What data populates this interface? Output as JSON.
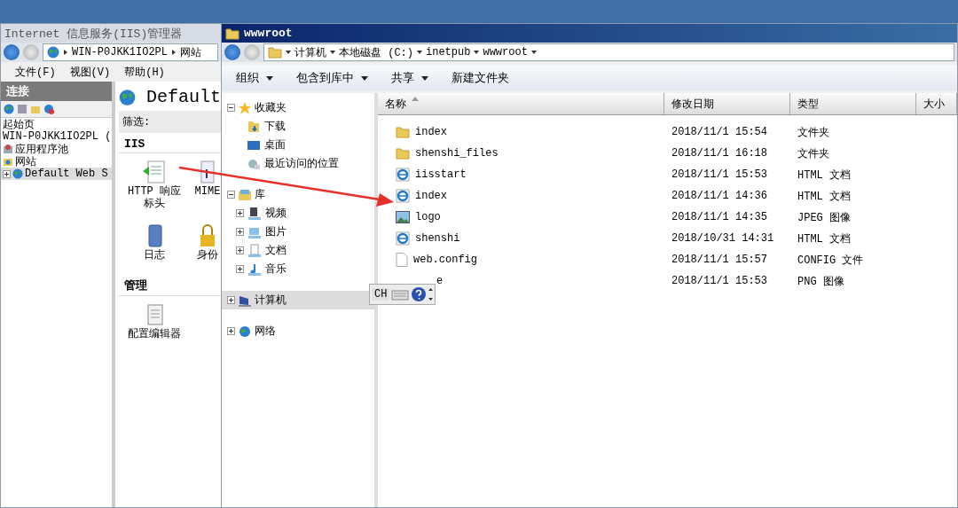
{
  "iis_window": {
    "title": "Internet 信息服务(IIS)管理器",
    "address": [
      "WIN-P0JKK1IO2PL",
      "网站"
    ],
    "menu": [
      "文件(F)",
      "视图(V)",
      "帮助(H)"
    ],
    "connections": {
      "title": "连接",
      "tree": [
        {
          "label": "起始页",
          "kind": "start",
          "selected": false
        },
        {
          "label": "WIN-P0JKK1IO2PL (",
          "kind": "server",
          "selected": false
        },
        {
          "label": "应用程序池",
          "kind": "pool",
          "selected": false
        },
        {
          "label": "网站",
          "kind": "sites",
          "selected": false
        },
        {
          "label": "Default Web S",
          "kind": "site",
          "selected": true,
          "expanded": false
        }
      ]
    },
    "content": {
      "heading": "Default",
      "filter_label": "筛选:",
      "groups": [
        {
          "title": "IIS",
          "features": [
            {
              "lines": [
                "HTTP 响应",
                "标头"
              ],
              "kind": "headers"
            },
            {
              "lines": [
                "MIME"
              ],
              "kind": "mime"
            },
            {
              "lines": [
                "日志"
              ],
              "kind": "log"
            },
            {
              "lines": [
                "身份"
              ],
              "kind": "auth"
            }
          ]
        },
        {
          "title": "管理",
          "features": [
            {
              "lines": [
                "配置编辑器"
              ],
              "kind": "config"
            }
          ]
        }
      ]
    }
  },
  "explorer_window": {
    "title": "wwwroot",
    "breadcrumbs": [
      "计算机",
      "本地磁盘 (C:)",
      "inetpub",
      "wwwroot"
    ],
    "toolbar": [
      {
        "label": "组织",
        "dropdown": true
      },
      {
        "label": "包含到库中",
        "dropdown": true
      },
      {
        "label": "共享",
        "dropdown": true
      },
      {
        "label": "新建文件夹",
        "dropdown": false
      }
    ],
    "nav": [
      {
        "label": "收藏夹",
        "kind": "star",
        "expanded": true,
        "selected": false,
        "children": [
          {
            "label": "下载",
            "kind": "download"
          },
          {
            "label": "桌面",
            "kind": "desktop"
          },
          {
            "label": "最近访问的位置",
            "kind": "recent"
          }
        ]
      },
      {
        "label": "库",
        "kind": "library",
        "expanded": true,
        "selected": false,
        "children": [
          {
            "label": "视频",
            "kind": "video"
          },
          {
            "label": "图片",
            "kind": "pictures"
          },
          {
            "label": "文档",
            "kind": "docs"
          },
          {
            "label": "音乐",
            "kind": "music"
          }
        ]
      },
      {
        "label": "计算机",
        "kind": "computer",
        "expanded": false,
        "selected": true
      },
      {
        "label": "网络",
        "kind": "network",
        "expanded": false,
        "selected": false
      }
    ],
    "columns": [
      {
        "label": "名称",
        "sorted": true
      },
      {
        "label": "修改日期",
        "sorted": false
      },
      {
        "label": "类型",
        "sorted": false
      },
      {
        "label": "大小",
        "sorted": false
      }
    ],
    "files": [
      {
        "name": "index",
        "kind": "folder",
        "modified": "2018/11/1 15:54",
        "type": "文件夹"
      },
      {
        "name": "shenshi_files",
        "kind": "folder",
        "modified": "2018/11/1 16:18",
        "type": "文件夹"
      },
      {
        "name": "iisstart",
        "kind": "html",
        "modified": "2018/11/1 15:53",
        "type": "HTML 文档"
      },
      {
        "name": "index",
        "kind": "html",
        "modified": "2018/11/1 14:36",
        "type": "HTML 文档"
      },
      {
        "name": "logo",
        "kind": "image",
        "modified": "2018/11/1 14:35",
        "type": "JPEG 图像"
      },
      {
        "name": "shenshi",
        "kind": "html",
        "modified": "2018/10/31 14:31",
        "type": "HTML 文档"
      },
      {
        "name": "web.config",
        "kind": "file",
        "modified": "2018/11/1 15:57",
        "type": "CONFIG 文件"
      },
      {
        "name": "e",
        "kind": "png",
        "modified": "2018/11/1 15:53",
        "type": "PNG 图像"
      }
    ]
  },
  "language_bar": {
    "language": "CH"
  }
}
